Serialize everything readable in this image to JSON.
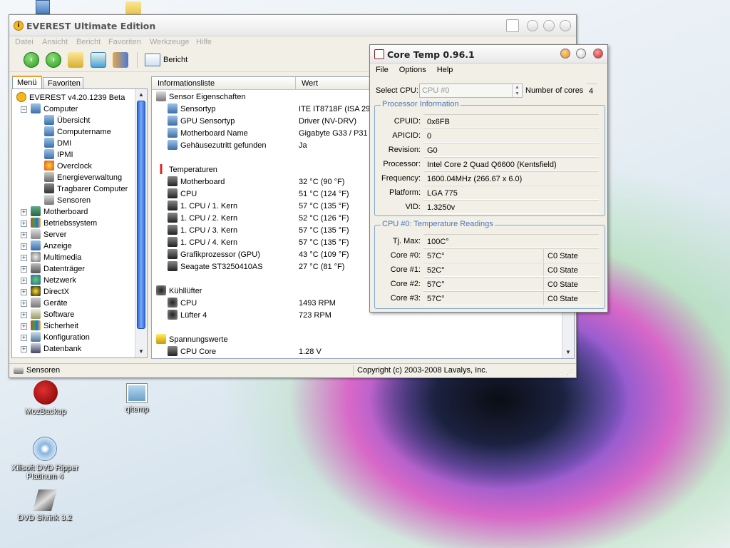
{
  "desktop": {
    "icons": [
      {
        "label": "MozBackup"
      },
      {
        "label": "qitemp"
      },
      {
        "label": "Xilisoft DVD Ripper"
      },
      {
        "label": "Platinum 4"
      },
      {
        "label": "DVD Shrink 3.2"
      }
    ]
  },
  "everest": {
    "title": "EVEREST Ultimate Edition",
    "menu": [
      "Datei",
      "Ansicht",
      "Bericht",
      "Favoriten",
      "Werkzeuge",
      "Hilfe"
    ],
    "toolbar": {
      "report_label": "Bericht"
    },
    "tabs": [
      "Menü",
      "Favoriten"
    ],
    "tree": {
      "root": "EVEREST v4.20.1239 Beta",
      "computer": "Computer",
      "computer_children": [
        "Übersicht",
        "Computername",
        "DMI",
        "IPMI",
        "Overclock",
        "Energieverwaltung",
        "Tragbarer Computer",
        "Sensoren"
      ],
      "top_items": [
        "Motherboard",
        "Betriebssystem",
        "Server",
        "Anzeige",
        "Multimedia",
        "Datenträger",
        "Netzwerk",
        "DirectX",
        "Geräte",
        "Software",
        "Sicherheit",
        "Konfiguration",
        "Datenbank"
      ]
    },
    "columns": {
      "field": "Informationsliste",
      "value": "Wert"
    },
    "sections": {
      "sensor": "Sensor Eigenschaften",
      "temps": "Temperaturen",
      "fans": "Kühllüfter",
      "volts": "Spannungswerte"
    },
    "sensor_rows": [
      {
        "label": "Sensortyp",
        "value": "ITE IT8718F  (ISA 29"
      },
      {
        "label": "GPU Sensortyp",
        "value": "Driver  (NV-DRV)"
      },
      {
        "label": "Motherboard Name",
        "value": "Gigabyte G33 / P31 /"
      },
      {
        "label": "Gehäusezutritt gefunden",
        "value": "Ja"
      }
    ],
    "temp_rows": [
      {
        "label": "Motherboard",
        "value": "32 °C  (90 °F)"
      },
      {
        "label": "CPU",
        "value": "51 °C  (124 °F)"
      },
      {
        "label": "1. CPU / 1. Kern",
        "value": "57 °C  (135 °F)"
      },
      {
        "label": "1. CPU / 2. Kern",
        "value": "52 °C  (126 °F)"
      },
      {
        "label": "1. CPU / 3. Kern",
        "value": "57 °C  (135 °F)"
      },
      {
        "label": "1. CPU / 4. Kern",
        "value": "57 °C  (135 °F)"
      },
      {
        "label": "Grafikprozessor (GPU)",
        "value": "43 °C  (109 °F)"
      },
      {
        "label": "Seagate ST3250410AS",
        "value": "27 °C  (81 °F)"
      }
    ],
    "fan_rows": [
      {
        "label": "CPU",
        "value": "1493 RPM"
      },
      {
        "label": "Lüfter 4",
        "value": "723 RPM"
      }
    ],
    "volt_rows": [
      {
        "label": "CPU Core",
        "value": "1.28 V"
      }
    ],
    "status": {
      "left": "Sensoren",
      "right": "Copyright (c) 2003-2008 Lavalys, Inc."
    }
  },
  "coretemp": {
    "title": "Core Temp 0.96.1",
    "menu": [
      "File",
      "Options",
      "Help"
    ],
    "select_cpu_label": "Select CPU:",
    "select_cpu_value": "CPU #0",
    "cores_label": "Number of cores",
    "cores_value": "4",
    "proc_group": "Processor Information",
    "proc": [
      {
        "label": "CPUID:",
        "value": "0x6FB"
      },
      {
        "label": "APICID:",
        "value": "0"
      },
      {
        "label": "Revision:",
        "value": "G0"
      },
      {
        "label": "Processor:",
        "value": "Intel Core 2 Quad Q6600 (Kentsfield)"
      },
      {
        "label": "Frequency:",
        "value": "1600.04MHz (266.67 x 6.0)"
      },
      {
        "label": "Platform:",
        "value": "LGA 775"
      },
      {
        "label": "VID:",
        "value": "1.3250v"
      }
    ],
    "temp_group": "CPU #0: Temperature Readings",
    "tjmax_label": "Tj. Max:",
    "tjmax_value": "100C°",
    "cores": [
      {
        "label": "Core #0:",
        "temp": "57C°",
        "state": "C0 State"
      },
      {
        "label": "Core #1:",
        "temp": "52C°",
        "state": "C0 State"
      },
      {
        "label": "Core #2:",
        "temp": "57C°",
        "state": "C0 State"
      },
      {
        "label": "Core #3:",
        "temp": "57C°",
        "state": "C0 State"
      }
    ]
  },
  "colors": {
    "accent": "#2f6bde",
    "group_border": "#7fa6d6",
    "group_title": "#4a78b8"
  }
}
